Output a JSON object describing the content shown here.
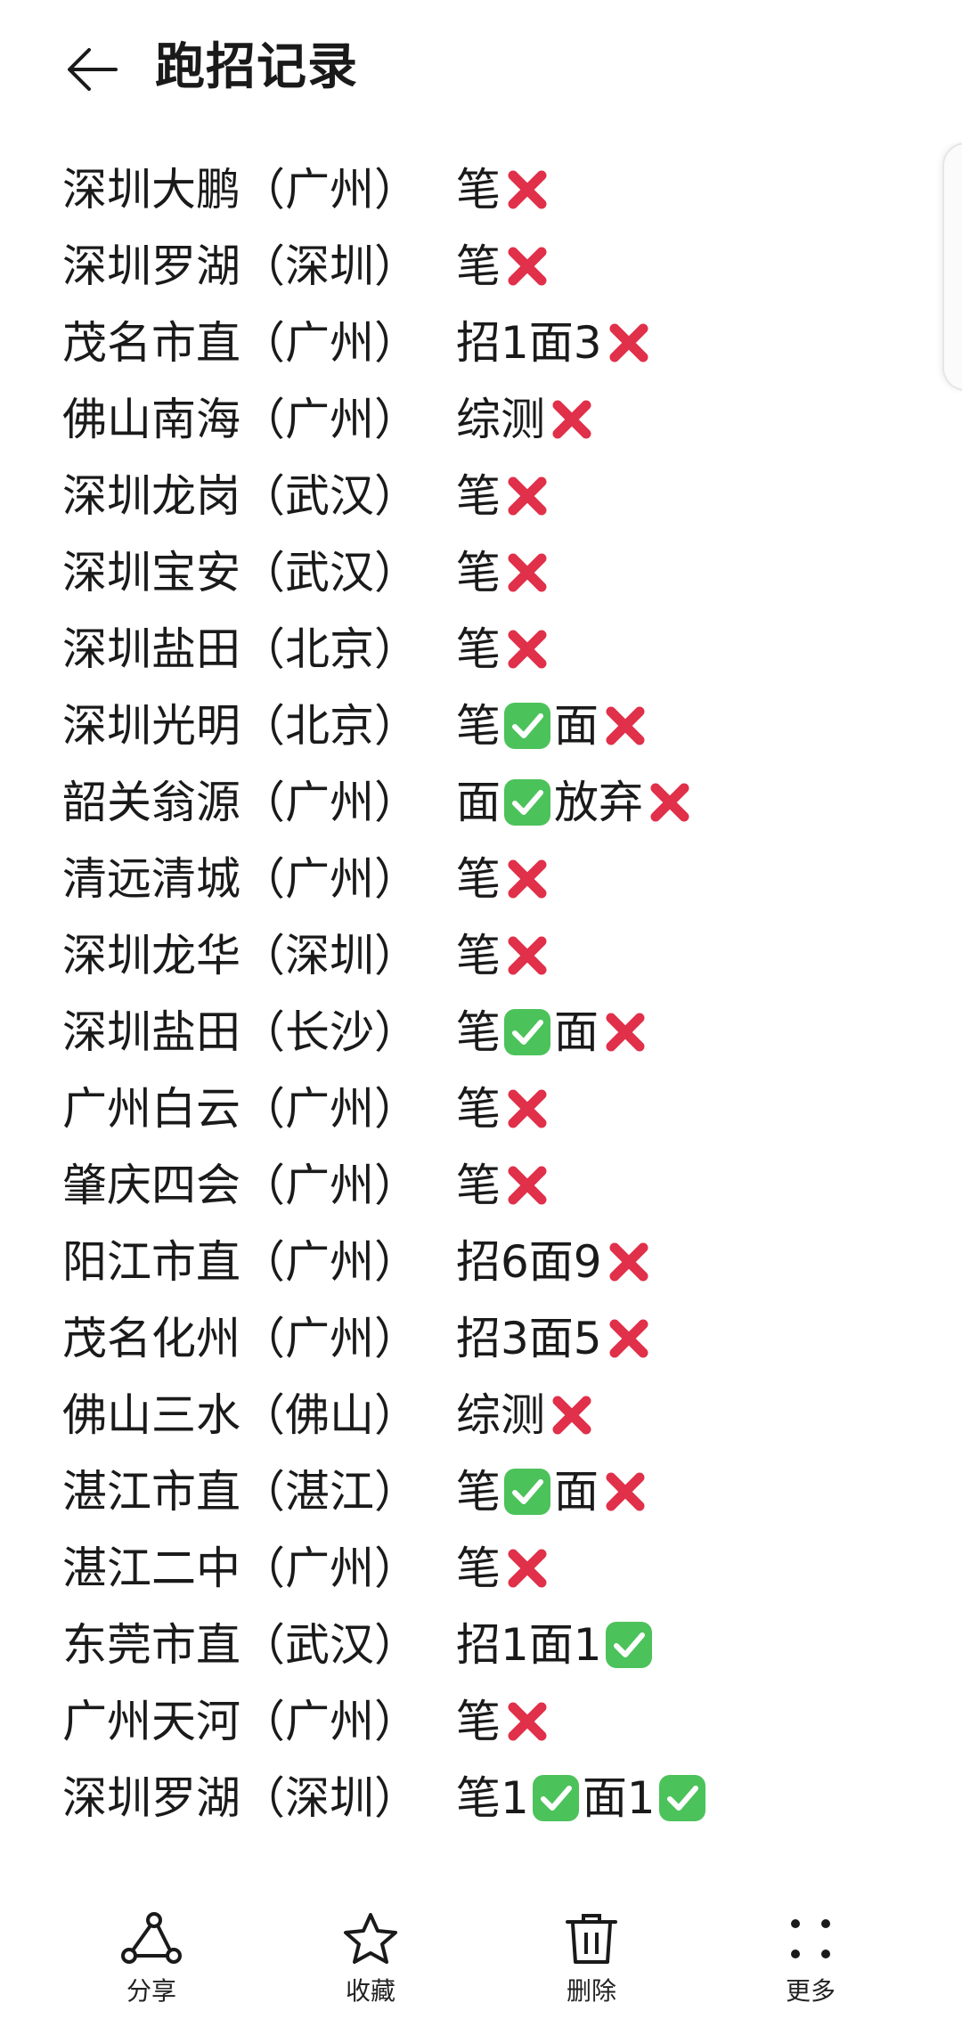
{
  "header": {
    "title": "跑招记录"
  },
  "records": [
    {
      "name": "深圳大鹏（广州）",
      "result": [
        {
          "t": "笔"
        },
        {
          "m": "cross"
        }
      ]
    },
    {
      "name": "深圳罗湖（深圳）",
      "result": [
        {
          "t": "笔"
        },
        {
          "m": "cross"
        }
      ]
    },
    {
      "name": "茂名市直（广州）",
      "result": [
        {
          "t": "招1面3"
        },
        {
          "m": "cross"
        }
      ]
    },
    {
      "name": "佛山南海（广州）",
      "result": [
        {
          "t": "综测"
        },
        {
          "m": "cross"
        }
      ]
    },
    {
      "name": "深圳龙岗（武汉）",
      "result": [
        {
          "t": "笔"
        },
        {
          "m": "cross"
        }
      ]
    },
    {
      "name": "深圳宝安（武汉）",
      "result": [
        {
          "t": "笔"
        },
        {
          "m": "cross"
        }
      ]
    },
    {
      "name": "深圳盐田（北京）",
      "result": [
        {
          "t": "笔"
        },
        {
          "m": "cross"
        }
      ]
    },
    {
      "name": "深圳光明（北京）",
      "result": [
        {
          "t": "笔"
        },
        {
          "m": "check"
        },
        {
          "t": "面"
        },
        {
          "m": "cross"
        }
      ]
    },
    {
      "name": "韶关翁源（广州）",
      "result": [
        {
          "t": "面"
        },
        {
          "m": "check"
        },
        {
          "t": "放弃"
        },
        {
          "m": "cross"
        }
      ]
    },
    {
      "name": "清远清城（广州）",
      "result": [
        {
          "t": "笔"
        },
        {
          "m": "cross"
        }
      ]
    },
    {
      "name": "深圳龙华（深圳）",
      "result": [
        {
          "t": "笔"
        },
        {
          "m": "cross"
        }
      ]
    },
    {
      "name": "深圳盐田（长沙）",
      "result": [
        {
          "t": "笔"
        },
        {
          "m": "check"
        },
        {
          "t": "面"
        },
        {
          "m": "cross"
        }
      ]
    },
    {
      "name": "广州白云（广州）",
      "result": [
        {
          "t": "笔"
        },
        {
          "m": "cross"
        }
      ]
    },
    {
      "name": "肇庆四会（广州）",
      "result": [
        {
          "t": "笔"
        },
        {
          "m": "cross"
        }
      ]
    },
    {
      "name": "阳江市直（广州）",
      "result": [
        {
          "t": "招6面9"
        },
        {
          "m": "cross"
        }
      ]
    },
    {
      "name": "茂名化州（广州）",
      "result": [
        {
          "t": "招3面5"
        },
        {
          "m": "cross"
        }
      ]
    },
    {
      "name": "佛山三水（佛山）",
      "result": [
        {
          "t": "综测"
        },
        {
          "m": "cross"
        }
      ]
    },
    {
      "name": "湛江市直（湛江）",
      "result": [
        {
          "t": "笔"
        },
        {
          "m": "check"
        },
        {
          "t": "面"
        },
        {
          "m": "cross"
        }
      ]
    },
    {
      "name": "湛江二中（广州）",
      "result": [
        {
          "t": "笔"
        },
        {
          "m": "cross"
        }
      ]
    },
    {
      "name": "东莞市直（武汉）",
      "result": [
        {
          "t": "招1面1"
        },
        {
          "m": "check"
        }
      ]
    },
    {
      "name": "广州天河（广州）",
      "result": [
        {
          "t": "笔"
        },
        {
          "m": "cross"
        }
      ]
    },
    {
      "name": "深圳罗湖（深圳）",
      "result": [
        {
          "t": "笔1"
        },
        {
          "m": "check"
        },
        {
          "t": "面1"
        },
        {
          "m": "check"
        }
      ]
    }
  ],
  "toolbar": {
    "share": "分享",
    "favorite": "收藏",
    "delete": "删除",
    "more": "更多"
  },
  "colors": {
    "check_green": "#4cc25b",
    "cross_red": "#e0304a"
  },
  "icons": {
    "check": "check-mark-icon",
    "cross": "cross-mark-icon"
  }
}
